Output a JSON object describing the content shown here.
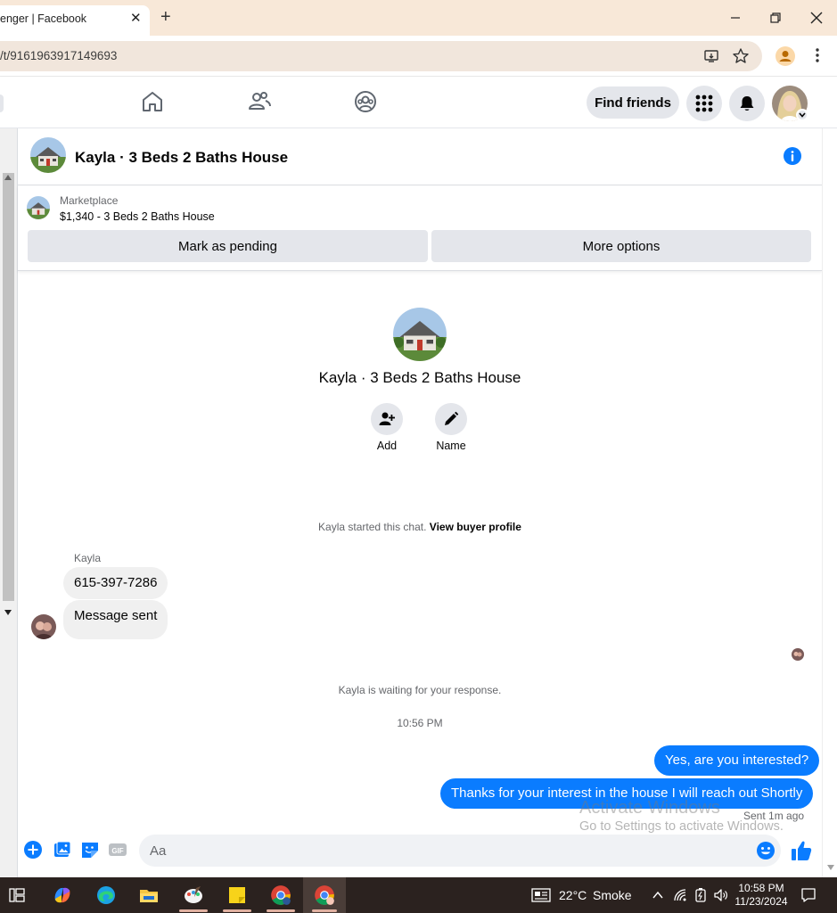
{
  "browser": {
    "tab_title": "enger | Facebook",
    "tab_close": "✕",
    "new_tab": "+",
    "url": "/t/9161963917149693"
  },
  "fb_nav": {
    "find_friends": "Find friends"
  },
  "chat": {
    "title": "Kayla · 3 Beds 2 Baths House"
  },
  "marketplace": {
    "label": "Marketplace",
    "listing": "$1,340 - 3 Beds 2 Baths House",
    "mark_pending": "Mark as pending",
    "more_options": "More options"
  },
  "intro": {
    "name": "Kayla · 3 Beds 2 Baths House",
    "add_label": "Add",
    "name_label": "Name"
  },
  "conversation": {
    "started_text": "Kayla started this chat.",
    "view_buyer_profile": "View buyer profile",
    "sender": "Kayla",
    "incoming": [
      "615-397-7286",
      "Message sent"
    ],
    "waiting": "Kayla is waiting for your response.",
    "time": "10:56 PM",
    "outgoing": [
      "Yes, are you interested?",
      "Thanks for your interest in the house I will reach out Shortly"
    ],
    "sent_status": "Sent 1m ago"
  },
  "watermark": {
    "line1": "Activate Windows",
    "line2": "Go to Settings to activate Windows."
  },
  "composer": {
    "placeholder": "Aa"
  },
  "taskbar": {
    "weather_temp": "22°C",
    "weather_desc": "Smoke",
    "time": "10:58 PM",
    "date": "11/23/2024"
  },
  "colors": {
    "messenger_blue": "#0a7cff",
    "fb_blue": "#1877f2"
  }
}
